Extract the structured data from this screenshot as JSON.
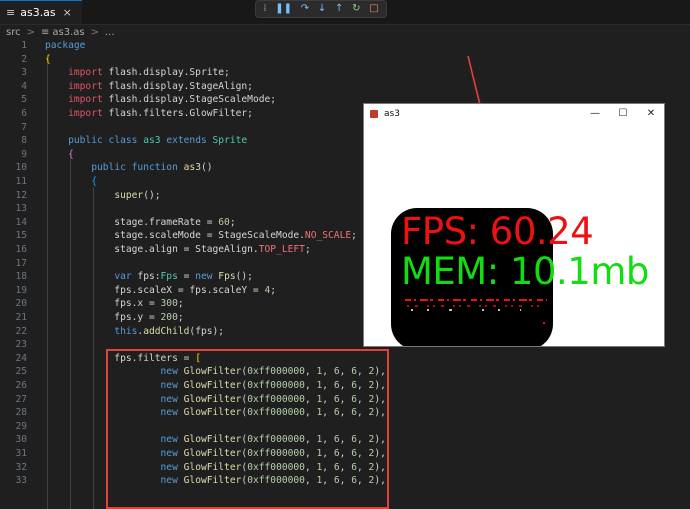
{
  "tab": {
    "label": "as3.as",
    "icon": "≡",
    "close": "×"
  },
  "debug_toolbar": {
    "items": [
      {
        "name": "drag-handle-icon",
        "glyph": "⁞"
      },
      {
        "name": "pause-icon",
        "glyph": "❚❚"
      },
      {
        "name": "step-over-icon",
        "glyph": "↷"
      },
      {
        "name": "step-into-icon",
        "glyph": "↓"
      },
      {
        "name": "step-out-icon",
        "glyph": "↑"
      },
      {
        "name": "restart-icon",
        "glyph": "↻"
      },
      {
        "name": "stop-icon",
        "glyph": "□"
      }
    ]
  },
  "breadcrumb": {
    "folder": "src",
    "sep1": ">",
    "file_icon": "≡",
    "file": "as3.as",
    "sep2": ">",
    "more": "..."
  },
  "code": {
    "lines": [
      {
        "n": "1",
        "t": "package"
      },
      {
        "n": "2",
        "t": "{"
      },
      {
        "n": "3",
        "t": "    import flash.display.Sprite;"
      },
      {
        "n": "4",
        "t": "    import flash.display.StageAlign;"
      },
      {
        "n": "5",
        "t": "    import flash.display.StageScaleMode;"
      },
      {
        "n": "6",
        "t": "    import flash.filters.GlowFilter;"
      },
      {
        "n": "7",
        "t": ""
      },
      {
        "n": "8",
        "t": "    public class as3 extends Sprite"
      },
      {
        "n": "9",
        "t": "    {"
      },
      {
        "n": "10",
        "t": "        public function as3()"
      },
      {
        "n": "11",
        "t": "        {"
      },
      {
        "n": "12",
        "t": "            super();"
      },
      {
        "n": "13",
        "t": ""
      },
      {
        "n": "14",
        "t": "            stage.frameRate = 60;"
      },
      {
        "n": "15",
        "t": "            stage.scaleMode = StageScaleMode.NO_SCALE;"
      },
      {
        "n": "16",
        "t": "            stage.align = StageAlign.TOP_LEFT;"
      },
      {
        "n": "17",
        "t": ""
      },
      {
        "n": "18",
        "t": "            var fps:Fps = new Fps();"
      },
      {
        "n": "19",
        "t": "            fps.scaleX = fps.scaleY = 4;"
      },
      {
        "n": "20",
        "t": "            fps.x = 300;"
      },
      {
        "n": "21",
        "t": "            fps.y = 200;"
      },
      {
        "n": "22",
        "t": "            this.addChild(fps);"
      },
      {
        "n": "23",
        "t": ""
      },
      {
        "n": "24",
        "t": "            fps.filters = ["
      },
      {
        "n": "25",
        "t": "                    new GlowFilter(0xff000000, 1, 6, 6, 2),"
      },
      {
        "n": "26",
        "t": "                    new GlowFilter(0xff000000, 1, 6, 6, 2),"
      },
      {
        "n": "27",
        "t": "                    new GlowFilter(0xff000000, 1, 6, 6, 2),"
      },
      {
        "n": "28",
        "t": "                    new GlowFilter(0xff000000, 1, 6, 6, 2),"
      },
      {
        "n": "29",
        "t": ""
      },
      {
        "n": "30",
        "t": "                    new GlowFilter(0xff000000, 1, 6, 6, 2),"
      },
      {
        "n": "31",
        "t": "                    new GlowFilter(0xff000000, 1, 6, 6, 2),"
      },
      {
        "n": "32",
        "t": "                    new GlowFilter(0xff000000, 1, 6, 6, 2),"
      },
      {
        "n": "33",
        "t": "                    new GlowFilter(0xff000000, 1, 6, 6, 2),"
      }
    ]
  },
  "flash_window": {
    "title": "as3",
    "minimize": "—",
    "maximize": "☐",
    "close": "✕",
    "fps_text": "FPS: 60.24",
    "mem_text": "MEM: 10.1mb",
    "fps_color": "#ee1111",
    "mem_color": "#11dd11"
  }
}
